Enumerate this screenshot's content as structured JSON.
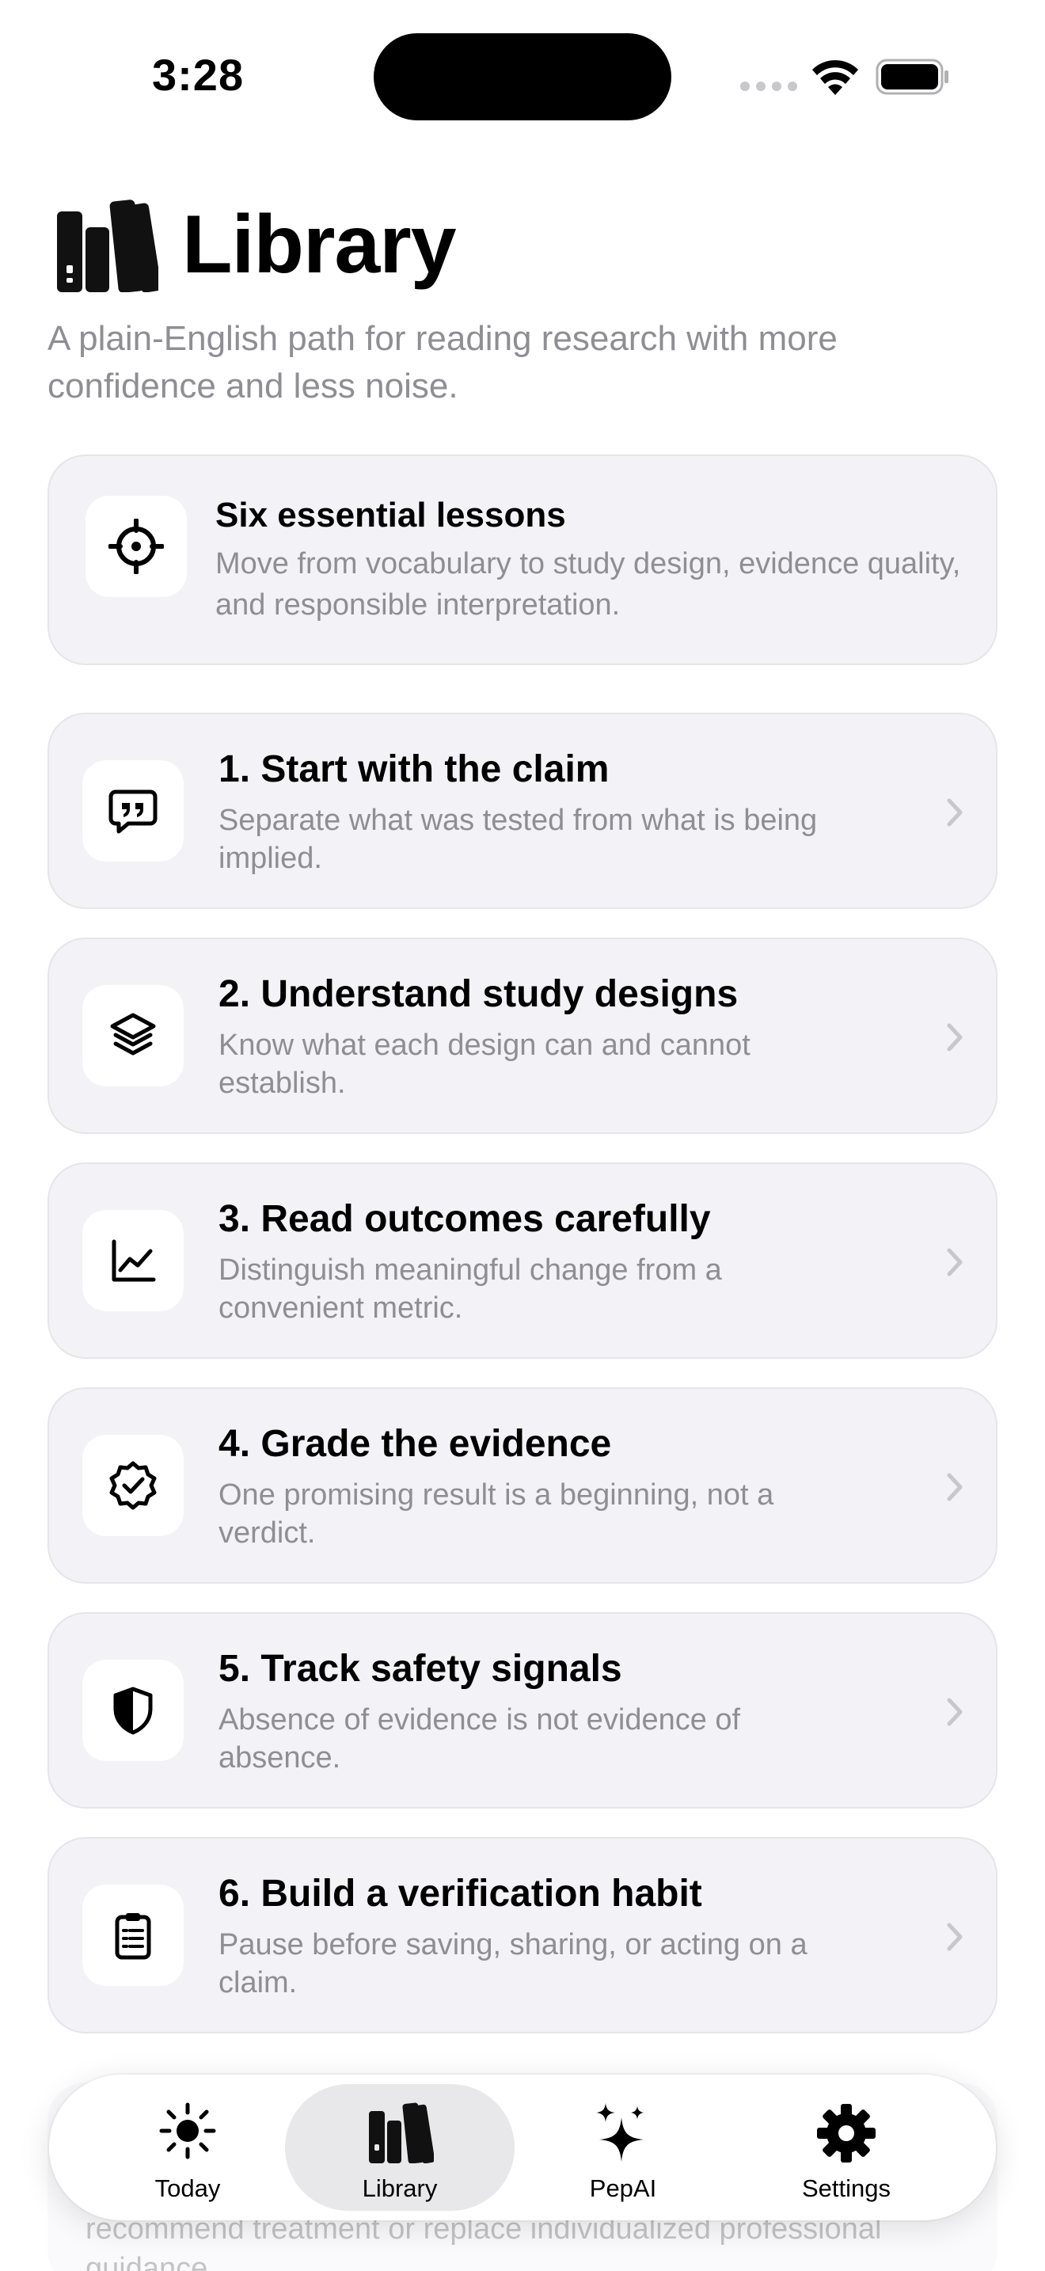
{
  "status_bar": {
    "time": "3:28"
  },
  "header": {
    "title": "Library",
    "subtitle": "A plain-English path for reading research with more confidence and less noise."
  },
  "intro_card": {
    "icon": "target-icon",
    "title": "Six essential lessons",
    "description": "Move from vocabulary to study design, evidence quality, and responsible interpretation."
  },
  "lessons": [
    {
      "icon": "quote-bubble-icon",
      "title": "1. Start with the claim",
      "description": "Separate what was tested from what is being implied."
    },
    {
      "icon": "layers-icon",
      "title": "2. Understand study designs",
      "description": "Know what each design can and cannot establish."
    },
    {
      "icon": "line-chart-icon",
      "title": "3. Read outcomes carefully",
      "description": "Distinguish meaningful change from a convenient metric."
    },
    {
      "icon": "verified-badge-icon",
      "title": "4. Grade the evidence",
      "description": "One promising result is a beginning, not a verdict."
    },
    {
      "icon": "shield-icon",
      "title": "5. Track safety signals",
      "description": "Absence of evidence is not evidence of absence."
    },
    {
      "icon": "clipboard-icon",
      "title": "6. Build a verification habit",
      "description": "Pause before saving, sharing, or acting on a claim."
    }
  ],
  "faded_note": {
    "text": "recommend treatment or replace individualized professional guidance."
  },
  "tab_bar": {
    "tabs": [
      {
        "label": "Today",
        "icon": "sun-icon",
        "active": false
      },
      {
        "label": "Library",
        "icon": "books-icon",
        "active": true
      },
      {
        "label": "PepAI",
        "icon": "sparkles-icon",
        "active": false
      },
      {
        "label": "Settings",
        "icon": "gear-icon",
        "active": false
      }
    ]
  },
  "colors": {
    "card_background": "#f2f2f7",
    "secondary_text": "#8e8e93",
    "primary_text": "#000000",
    "active_tab": "#e8e8ea"
  }
}
